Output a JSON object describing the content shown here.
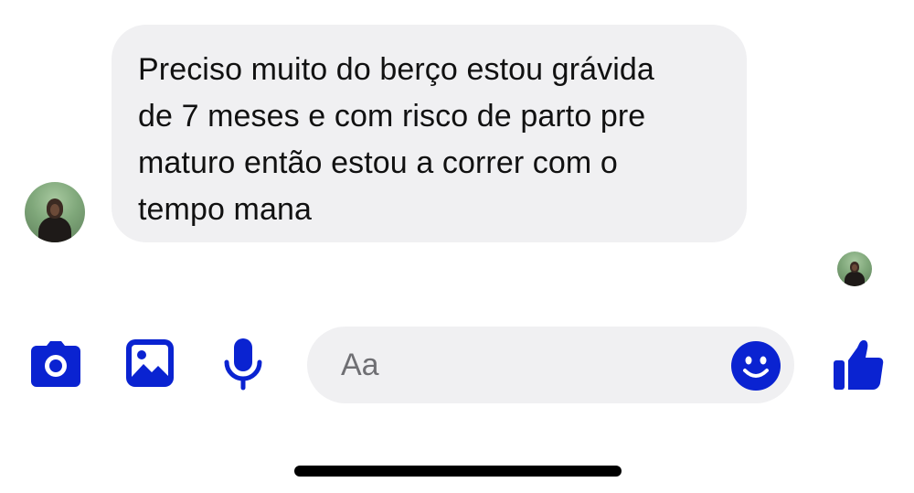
{
  "conversation": {
    "messages": [
      {
        "direction": "incoming",
        "text": "Preciso muito do berço estou grávida\nde 7 meses e com risco de parto pre\nmaturo então estou a correr com o\ntempo mana"
      }
    ]
  },
  "composer": {
    "placeholder": "Aa",
    "icons": {
      "camera": "camera-icon",
      "gallery": "image-icon",
      "microphone": "microphone-icon",
      "emoji": "smiley-icon",
      "like": "thumbs-up-icon"
    }
  },
  "colors": {
    "accent": "#0a23d1",
    "bubble_background": "#f0f0f2",
    "text": "#111111",
    "placeholder": "#6f6f73"
  }
}
